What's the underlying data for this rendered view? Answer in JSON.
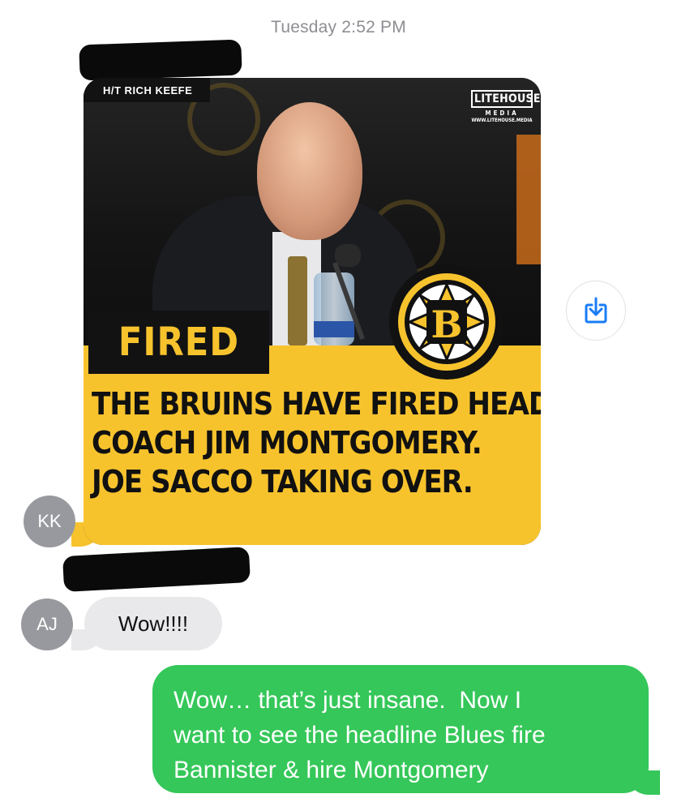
{
  "timestamp": "Tuesday 2:52 PM",
  "messages": {
    "image_message": {
      "sender_initials": "KK",
      "credit": "H/T RICH KEEFE",
      "watermark": {
        "title": "LITEHOUSE",
        "subtitle": "MEDIA",
        "url": "WWW.LITEHOUSE.MEDIA"
      },
      "badge": "FIRED",
      "headline_lines": [
        "THE BRUINS HAVE FIRED HEAD",
        "COACH JIM MONTGOMERY.",
        "JOE SACCO TAKING OVER."
      ],
      "logo_letter": "B",
      "colors": {
        "panel": "#f7c32d",
        "dark": "#121212"
      }
    },
    "reply_message": {
      "sender_initials": "AJ",
      "text": "Wow!!!!"
    },
    "sent_message": {
      "lines": [
        "Wow… that’s just insane.  Now I",
        "want to see the headline Blues fire",
        "Bannister & hire Montgomery"
      ],
      "color": "#35c759"
    }
  },
  "icons": {
    "save": "download-icon"
  }
}
